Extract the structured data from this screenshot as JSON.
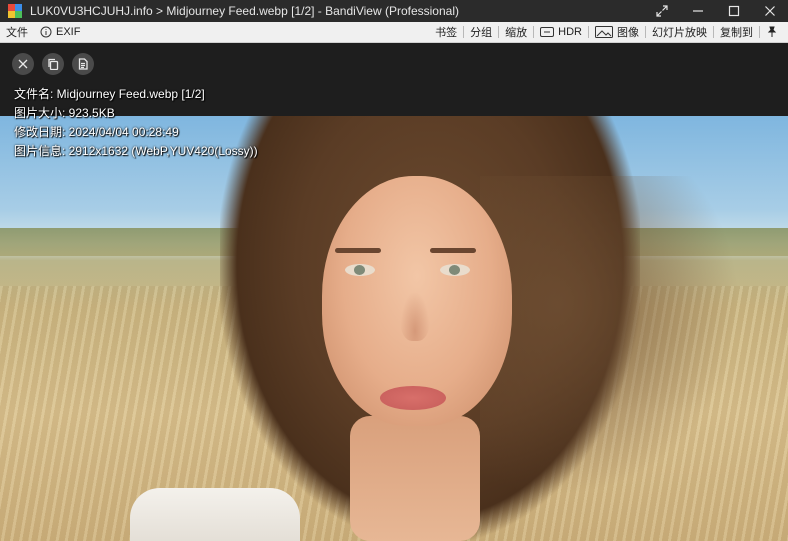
{
  "window": {
    "title": "LUK0VU3HCJUHJ.info > Midjourney Feed.webp [1/2] - BandiView (Professional)"
  },
  "menubar": {
    "file": "文件",
    "exif": "EXIF",
    "bookmark": "书签",
    "split": "分组",
    "zoom": "缩放",
    "hdr": "HDR",
    "image": "图像",
    "slideshow": "幻灯片放映",
    "copy_to": "复制到"
  },
  "info": {
    "filename": "文件名: Midjourney Feed.webp [1/2]",
    "filesize": "图片大小: 923.5KB",
    "modified": "修改日期: 2024/04/04 00:28:49",
    "imageinfo": "图片信息: 2912x1632 (WebP,YUV420(Lossy))"
  },
  "colors": {
    "titlebar": "#2b2b2b",
    "menubar": "#f0f0f0",
    "viewer_bg": "#1e1e1e"
  },
  "icons": [
    "app-logo-icon",
    "maximize-arrows-icon",
    "minimize-icon",
    "restore-icon",
    "close-icon",
    "info-icon",
    "hdr-icon",
    "image-icon",
    "pin-icon",
    "close-circle-icon",
    "copy-icon",
    "document-icon"
  ]
}
